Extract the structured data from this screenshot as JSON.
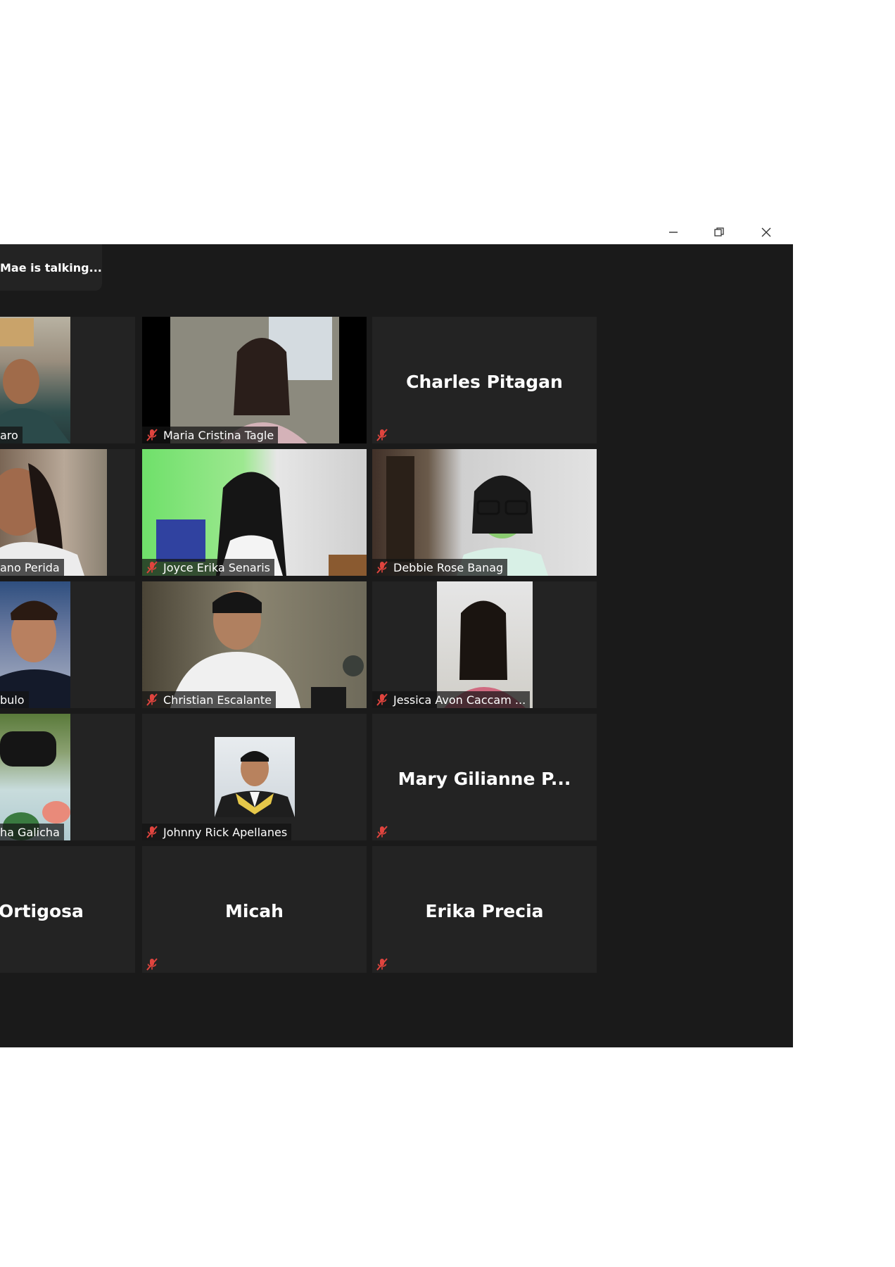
{
  "window": {
    "controls": [
      "minimize",
      "restore",
      "close"
    ]
  },
  "banner": {
    "talking_text": "Mae is talking..."
  },
  "colors": {
    "background": "#1a1a1a",
    "tile": "#232323",
    "mic_muted": "#e0443e",
    "name_text": "#ffffff"
  },
  "tiles": {
    "r1c0": {
      "name": "aro",
      "video": true
    },
    "r1c1": {
      "name": "Maria Cristina Tagle",
      "video": true
    },
    "r1c2": {
      "name": "Charles Pitagan",
      "video": false
    },
    "r2c0": {
      "name": "ano Perida",
      "video": true
    },
    "r2c1": {
      "name": "Joyce Erika Senaris",
      "video": true
    },
    "r2c2": {
      "name": "Debbie Rose Banag",
      "video": true
    },
    "r3c0": {
      "name": "bulo",
      "video": true
    },
    "r3c1": {
      "name": "Christian Escalante",
      "video": true
    },
    "r3c2": {
      "name": "Jessica Avon Caccam ...",
      "video": true
    },
    "r4c0": {
      "name": "ha Galicha",
      "video": true
    },
    "r4c1": {
      "name": "Johnny Rick Apellanes",
      "video": true
    },
    "r4c2": {
      "name": "Mary Gilianne P...",
      "video": false
    },
    "r5c0": {
      "name": "Ortigosa",
      "video": false
    },
    "r5c1": {
      "name": "Micah",
      "video": false
    },
    "r5c2": {
      "name": "Erika Precia",
      "video": false
    }
  }
}
